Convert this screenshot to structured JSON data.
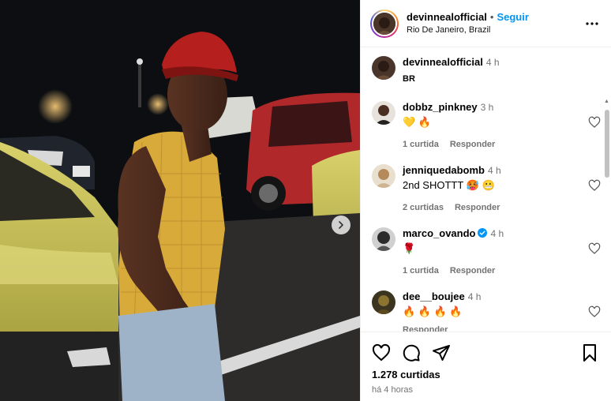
{
  "post": {
    "author": "devinnealofficial",
    "separator": "•",
    "follow_label": "Seguir",
    "location": "Rio De Janeiro, Brazil",
    "more_icon": "more-horizontal-icon"
  },
  "caption": {
    "username": "devinnealofficial",
    "time": "4 h",
    "text": "BR"
  },
  "comments": [
    {
      "username": "dobbz_pinkney",
      "time": "3 h",
      "text": "💛 🔥",
      "likes": "1 curtida",
      "reply": "Responder",
      "verified": false
    },
    {
      "username": "jenniquedabomb",
      "time": "4 h",
      "text": "2nd SHOTTT 🥵 😬",
      "likes": "2 curtidas",
      "reply": "Responder",
      "verified": false
    },
    {
      "username": "marco_ovando",
      "time": "4 h",
      "text": "🌹",
      "likes": "1 curtida",
      "reply": "Responder",
      "verified": true
    },
    {
      "username": "dee__boujee",
      "time": "4 h",
      "text": "🔥 🔥 🔥 🔥",
      "likes": "",
      "reply": "Responder",
      "verified": false
    }
  ],
  "footer": {
    "likes": "1.278 curtidas",
    "time": "há 4 horas"
  },
  "colors": {
    "accent": "#0095f6",
    "muted": "#737373"
  }
}
